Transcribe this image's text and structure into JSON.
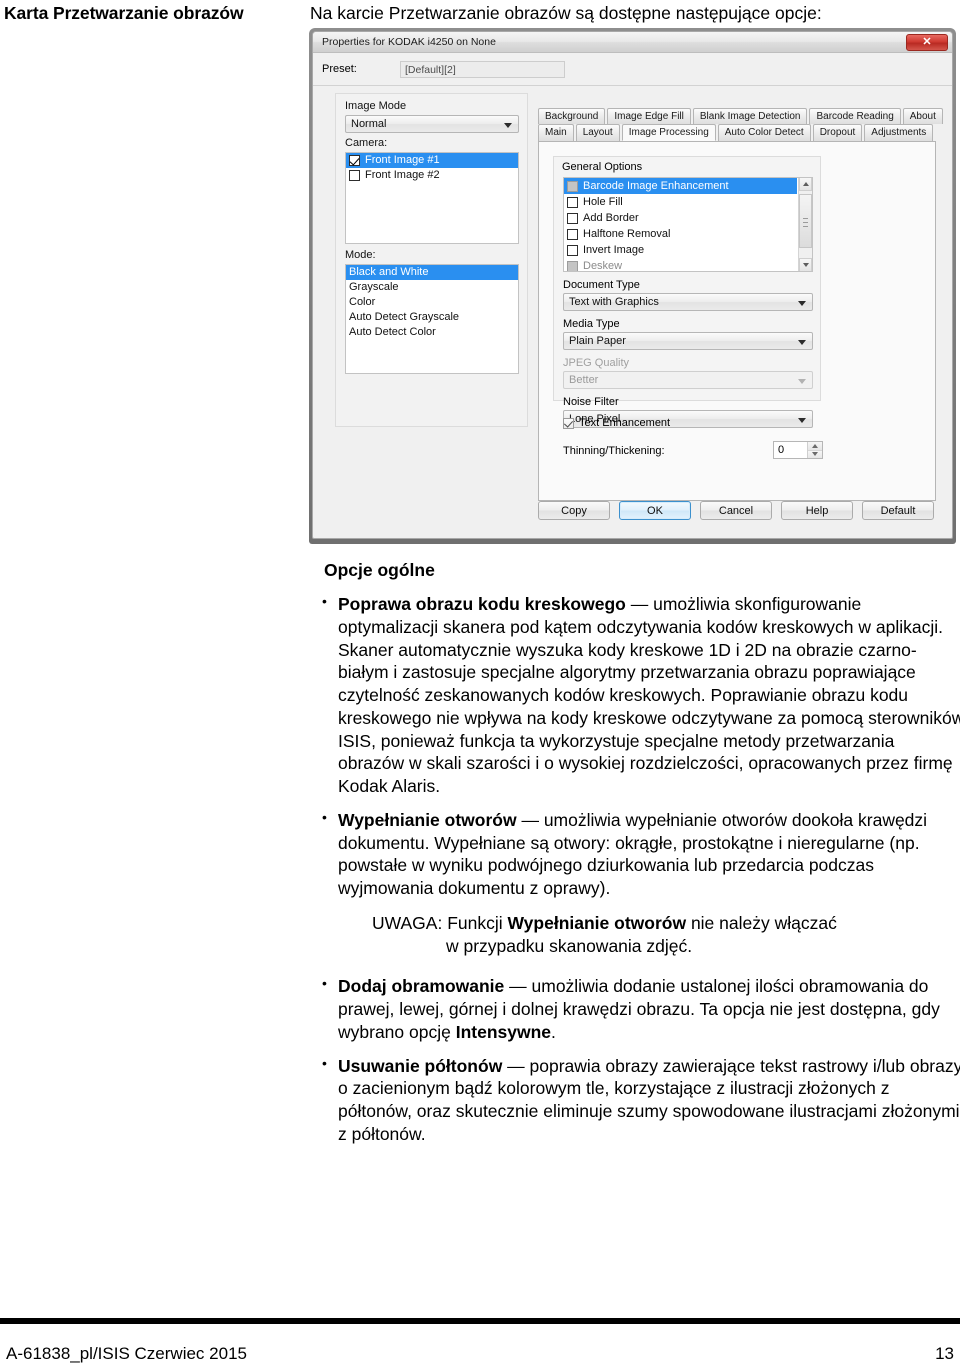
{
  "margin_heading": "Karta Przetwarzanie obrazów",
  "intro_line": "Na karcie Przetwarzanie obrazów są dostępne następujące opcje:",
  "dialog": {
    "title": "Properties for KODAK i4250 on None",
    "close_label": "✕",
    "preset": {
      "label": "Preset:",
      "value": "[Default][2]"
    },
    "left_pane": {
      "image_mode_label": "Image Mode",
      "image_mode_value": "Normal",
      "camera_label": "Camera:",
      "camera_items": [
        {
          "label": "Front Image #1",
          "checked": true,
          "selected": true
        },
        {
          "label": "Front Image #2",
          "checked": false,
          "selected": false
        }
      ],
      "mode_label": "Mode:",
      "mode_items": [
        {
          "label": "Black and White",
          "selected": true
        },
        {
          "label": "Grayscale",
          "selected": false
        },
        {
          "label": "Color",
          "selected": false
        },
        {
          "label": "Auto Detect Grayscale",
          "selected": false
        },
        {
          "label": "Auto Detect Color",
          "selected": false
        }
      ]
    },
    "tabs_row1": [
      "Background",
      "Image Edge Fill",
      "Blank Image Detection",
      "Barcode Reading",
      "About"
    ],
    "tabs_row2": [
      "Main",
      "Layout",
      "Image Processing",
      "Auto Color Detect",
      "Dropout",
      "Adjustments"
    ],
    "active_tab": "Image Processing",
    "general_options": {
      "title": "General Options",
      "items": [
        {
          "label": "Barcode Image Enhancement",
          "checked": false,
          "gray": true,
          "selected": true
        },
        {
          "label": "Hole Fill",
          "checked": false,
          "gray": false,
          "selected": false
        },
        {
          "label": "Add Border",
          "checked": false,
          "gray": false,
          "selected": false
        },
        {
          "label": "Halftone Removal",
          "checked": false,
          "gray": false,
          "selected": false
        },
        {
          "label": "Invert Image",
          "checked": false,
          "gray": false,
          "selected": false
        },
        {
          "label": "Deskew",
          "checked": false,
          "gray": true,
          "selected": false
        }
      ]
    },
    "document_type": {
      "label": "Document Type",
      "value": "Text with Graphics",
      "disabled": false
    },
    "media_type": {
      "label": "Media Type",
      "value": "Plain Paper",
      "disabled": false
    },
    "jpeg_quality": {
      "label": "JPEG Quality",
      "value": "Better",
      "disabled": true
    },
    "noise_filter": {
      "label": "Noise Filter",
      "value": "Lone Pixel",
      "disabled": false
    },
    "text_enhancement": {
      "label": "Text Enhancement",
      "checked": true
    },
    "thinning": {
      "label": "Thinning/Thickening:",
      "value": "0"
    },
    "buttons": [
      "Copy",
      "OK",
      "Cancel",
      "Help",
      "Default"
    ]
  },
  "content": {
    "section_heading": "Opcje ogólne",
    "bullets": [
      {
        "term": "Poprawa obrazu kodu kreskowego",
        "body": " — umożliwia skonfigurowanie optymalizacji skanera pod kątem odczytywania kodów kreskowych w aplikacji. Skaner automatycznie wyszuka kody kreskowe 1D i 2D na obrazie czarno-białym i zastosuje specjalne algorytmy przetwarzania obrazu poprawiające czytelność zeskanowanych kodów kreskowych. Poprawianie obrazu kodu kreskowego nie wpływa na kody kreskowe odczytywane za pomocą sterowników ISIS, ponieważ funkcja ta wykorzystuje specjalne metody przetwarzania obrazów w skali szarości i o wysokiej rozdzielczości, opracowanych przez firmę Kodak Alaris."
      },
      {
        "term": "Wypełnianie otworów",
        "body": " — umożliwia wypełnianie otworów dookoła krawędzi dokumentu. Wypełniane są otwory: okrągłe, prostokątne i nieregularne (np. powstałe w wyniku podwójnego dziurkowania lub przedarcia podczas wyjmowania dokumentu z oprawy)."
      },
      {
        "term": "Dodaj obramowanie",
        "body": " — umożliwia dodanie ustalonej ilości obramowania do prawej, lewej, górnej i dolnej krawędzi obrazu. Ta opcja nie jest dostępna, gdy wybrano opcję ",
        "tail_bold": "Intensywne",
        "tail": "."
      },
      {
        "term": "Usuwanie półtonów",
        "body": " — poprawia obrazy zawierające tekst rastrowy i/lub obrazy o zacienionym bądź kolorowym tle, korzystające z ilustracji złożonych z półtonów, oraz skutecznie eliminuje szumy spowodowane ilustracjami złożonymi z półtonów."
      }
    ],
    "note": {
      "prefix": "UWAGA:",
      "pre_bold": " Funkcji ",
      "bold": "Wypełnianie otworów",
      "post_bold": " nie należy włączać",
      "line2": "w przypadku skanowania zdjęć."
    }
  },
  "footer": {
    "left": "A-61838_pl/ISIS  Czerwiec 2015",
    "right": "13"
  }
}
